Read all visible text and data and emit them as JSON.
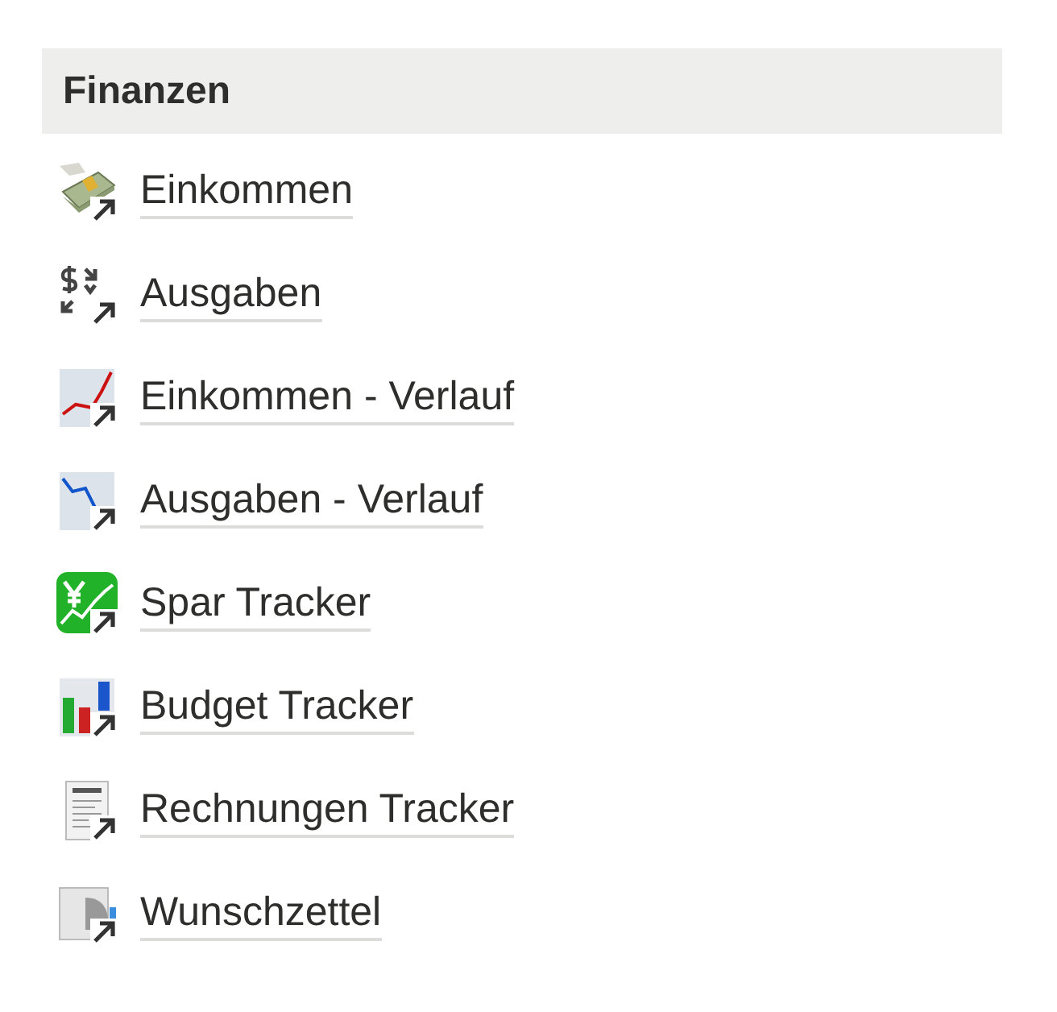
{
  "section": {
    "title": "Finanzen"
  },
  "links": [
    {
      "label": "Einkommen"
    },
    {
      "label": "Ausgaben"
    },
    {
      "label": "Einkommen - Verlauf"
    },
    {
      "label": "Ausgaben - Verlauf"
    },
    {
      "label": "Spar Tracker"
    },
    {
      "label": "Budget Tracker"
    },
    {
      "label": "Rechnungen Tracker"
    },
    {
      "label": "Wunschzettel"
    }
  ]
}
